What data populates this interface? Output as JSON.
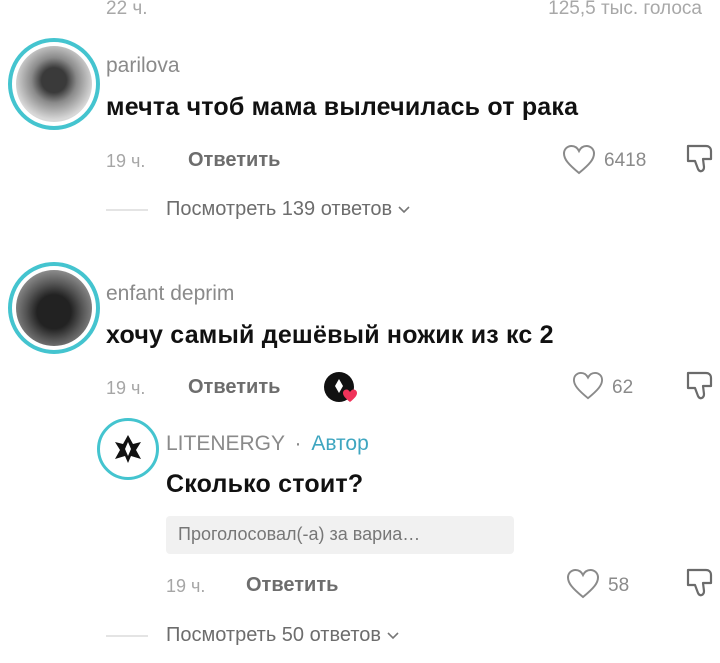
{
  "header": {
    "time": "22 ч.",
    "votes": "125,5 тыс. голоса"
  },
  "comments": [
    {
      "username": "parilova",
      "text": "мечта чтоб мама вылечилась от рака",
      "time": "19 ч.",
      "reply_label": "Ответить",
      "likes": "6418",
      "view_replies": "Посмотреть 139 ответов"
    },
    {
      "username": "enfant deprim",
      "text": "хочу самый дешёвый ножик из кс 2",
      "time": "19 ч.",
      "reply_label": "Ответить",
      "likes": "62"
    }
  ],
  "author_reply": {
    "username": "LITENERGY",
    "separator": "·",
    "badge": "Автор",
    "text": "Сколько стоит?",
    "vote_label": "Проголосовал(-а) за вариа…",
    "time": "19 ч.",
    "reply_label": "Ответить",
    "likes": "58",
    "view_replies": "Посмотреть 50 ответов"
  },
  "icons": {
    "like": "heart-icon",
    "dislike": "thumbs-down-icon",
    "expand": "chevron-down-icon",
    "creator_liked": "creator-liked-heart-icon"
  },
  "colors": {
    "accent": "#44c4cf",
    "author": "#3fa6c0",
    "liked_heart": "#f0335a"
  }
}
